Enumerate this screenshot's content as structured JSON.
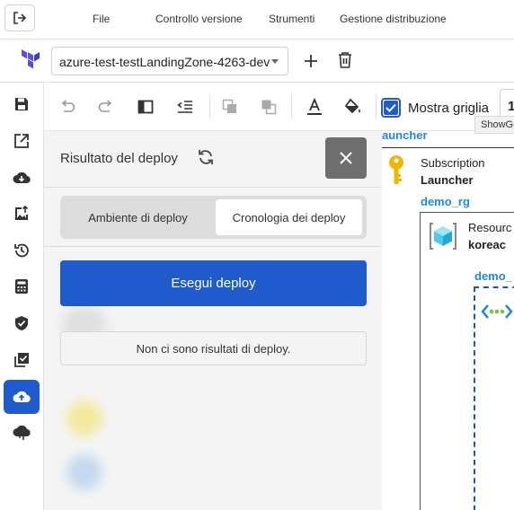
{
  "menu": {
    "items": [
      "File",
      "Controllo versione",
      "Strumenti",
      "Gestione distribuzione"
    ]
  },
  "project": {
    "name": "azure-test-testLandingZone-4263-dev"
  },
  "toolbar": {
    "show_grid_label": "Mostra griglia",
    "show_grid_checked": true,
    "zoom_value": "1",
    "tooltip": "ShowGrid"
  },
  "canvas": {
    "partial_label_top": "auncher",
    "subscription_label": "Subscription",
    "subscription_name": "Launcher",
    "rg_label": "demo_rg",
    "resource_label": "Resourc",
    "resource_name": "koreac",
    "vnet_label": "demo_"
  },
  "panel": {
    "title": "Risultato del deploy",
    "tabs": [
      "Ambiente di deploy",
      "Cronologia dei deploy"
    ],
    "active_tab": 1,
    "deploy_button": "Esegui deploy",
    "no_results": "Non ci sono risultati di deploy."
  },
  "colors": {
    "accent": "#1f5bcc",
    "link": "#1e88e5",
    "terraform": "#5c4ee5",
    "key": "#f5b400"
  }
}
